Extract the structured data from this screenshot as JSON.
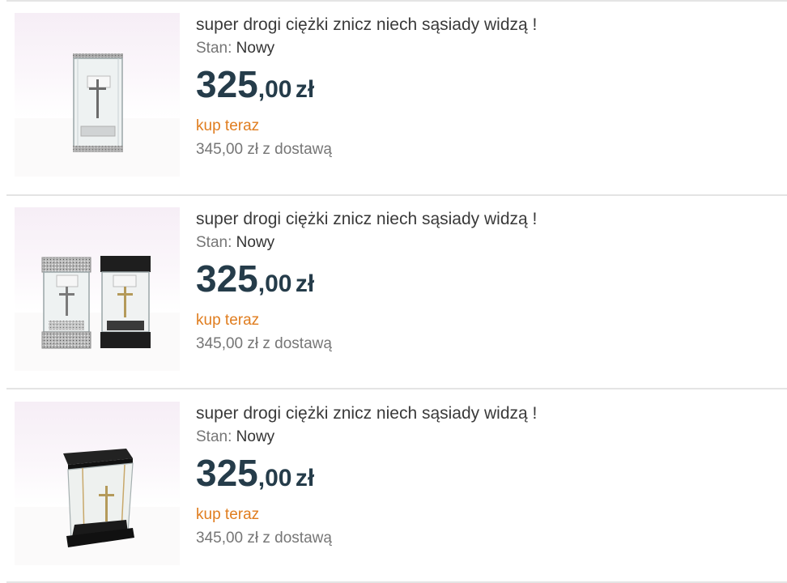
{
  "listings": [
    {
      "title": "super drogi ciężki znicz niech sąsiady widzą !",
      "condition_label": "Stan:",
      "condition_value": "Nowy",
      "price_integer": "325",
      "price_decimal": ",00",
      "price_currency": "zł",
      "buy_now_label": "kup teraz",
      "shipping_price": "345,00 zł z dostawą"
    },
    {
      "title": "super drogi ciężki znicz niech sąsiady widzą !",
      "condition_label": "Stan:",
      "condition_value": "Nowy",
      "price_integer": "325",
      "price_decimal": ",00",
      "price_currency": "zł",
      "buy_now_label": "kup teraz",
      "shipping_price": "345,00 zł z dostawą"
    },
    {
      "title": "super drogi ciężki znicz niech sąsiady widzą !",
      "condition_label": "Stan:",
      "condition_value": "Nowy",
      "price_integer": "325",
      "price_decimal": ",00",
      "price_currency": "zł",
      "buy_now_label": "kup teraz",
      "shipping_price": "345,00 zł z dostawą"
    }
  ],
  "colors": {
    "title": "#3a3a3a",
    "price": "#253c4a",
    "buy_now": "#e07d1f",
    "muted": "#767676",
    "divider": "#e4e4e4"
  }
}
